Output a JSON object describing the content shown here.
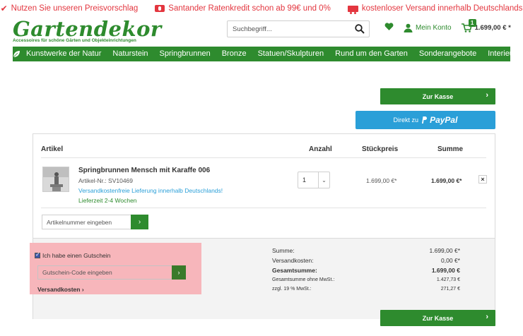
{
  "promo": [
    {
      "icon": "check-icon",
      "text": "Nutzen Sie unseren Preisvorschlag"
    },
    {
      "icon": "flag-icon",
      "text": "Santander Ratenkredit schon ab 99€ und 0%"
    },
    {
      "icon": "truck-icon",
      "text": "kostenloser Versand innerhalb Deutschlands"
    }
  ],
  "header": {
    "logo_title": "Gartendekor",
    "logo_subtitle": "Accessoires für schöne Gärten und Objekteinrichtungen",
    "search_placeholder": "Suchbegriff...",
    "account_label": "Mein Konto",
    "cart_count": "1",
    "cart_total": "1.699,00 € *"
  },
  "nav": [
    "Kunstwerke der Natur",
    "Naturstein",
    "Springbrunnen",
    "Bronze",
    "Statuen/Skulpturen",
    "Rund um den Garten",
    "Sonderangebote",
    "Interieur"
  ],
  "buttons": {
    "checkout": "Zur Kasse",
    "paypal_prefix": "Direkt zu",
    "paypal_logo": "PayPal"
  },
  "cart": {
    "headers": {
      "article": "Artikel",
      "quantity": "Anzahl",
      "unit_price": "Stückpreis",
      "sum": "Summe"
    },
    "item": {
      "name": "Springbrunnen Mensch mit Karaffe 006",
      "sku": "Artikel-Nr.: SV10469",
      "shipping": "Versandkostenfreie Lieferung innerhalb Deutschlands!",
      "delivery": "Lieferzeit 2-4 Wochen",
      "quantity": "1",
      "unit_price": "1.699,00 €*",
      "sum": "1.699,00 €*",
      "remove": "×"
    },
    "add_placeholder": "Artikelnummer eingeben",
    "voucher": {
      "checkbox_label": "Ich habe einen Gutschein",
      "placeholder": "Gutschein-Code eingeben",
      "shipping_link": "Versandkosten ›"
    },
    "totals": [
      {
        "label": "Summe:",
        "value": "1.699,00 €*",
        "style": "n"
      },
      {
        "label": "Versandkosten:",
        "value": "0,00 €*",
        "style": "n"
      },
      {
        "label": "Gesamtsumme:",
        "value": "1.699,00 €",
        "style": "b"
      },
      {
        "label": "Gesamtsumme ohne MwSt.:",
        "value": "1.427,73 €",
        "style": "s"
      },
      {
        "label": "zzgl. 19 % MwSt.:",
        "value": "271,27 €",
        "style": "s"
      }
    ]
  },
  "colors": {
    "brand_green": "#2e8b2e",
    "promo_red": "#e3363f",
    "paypal_blue": "#2a9fd8",
    "highlight": "#f7b6bb"
  }
}
